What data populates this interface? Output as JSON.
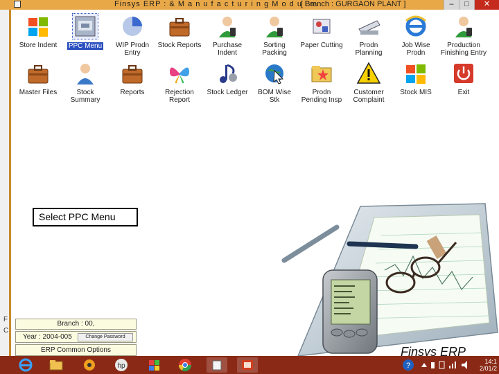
{
  "window": {
    "title": "Finsys ERP : & M a n u f a c t u r i n g   M o d u l e",
    "branch": "[ Branch : GURGAON PLANT ]",
    "minimize": "–",
    "maximize": "□",
    "close": "✕"
  },
  "left_frame": {
    "frag_top": "F",
    "frag_bottom": "C"
  },
  "icons": [
    {
      "label": "Store Indent",
      "icon": "windows-logo-icon"
    },
    {
      "label": "PPC Menu",
      "icon": "ppc-menu-icon",
      "selected": true
    },
    {
      "label": "WIP Prodn\nEntry",
      "icon": "pie-chart-icon"
    },
    {
      "label": "Stock Reports",
      "icon": "briefcase-icon"
    },
    {
      "label": "Purchase\nIndent",
      "icon": "user-phone-icon"
    },
    {
      "label": "Sorting\nPacking",
      "icon": "user-phone-icon"
    },
    {
      "label": "Paper Cutting",
      "icon": "tools-icon"
    },
    {
      "label": "Prodn\nPlanning",
      "icon": "scanner-icon"
    },
    {
      "label": "Job Wise\nProdn",
      "icon": "internet-explorer-icon"
    },
    {
      "label": "Production\nFinishing Entry",
      "icon": "user-phone-icon"
    },
    {
      "label": "Master Files",
      "icon": "briefcase-icon"
    },
    {
      "label": "Stock\nSummary",
      "icon": "user-icon"
    },
    {
      "label": "Reports",
      "icon": "briefcase-icon"
    },
    {
      "label": "Rejection\nReport",
      "icon": "butterfly-icon"
    },
    {
      "label": "Stock Ledger",
      "icon": "music-note-icon"
    },
    {
      "label": "BOM Wise\nStk",
      "icon": "globe-cursor-icon"
    },
    {
      "label": "Prodn\nPending Insp",
      "icon": "folder-star-icon"
    },
    {
      "label": "Customer\nComplaint",
      "icon": "warning-icon"
    },
    {
      "label": "Stock MIS",
      "icon": "windows-logo-icon"
    },
    {
      "label": "Exit",
      "icon": "power-icon"
    }
  ],
  "hint": "Select PPC Menu",
  "panels": {
    "branch": "Branch : 00,",
    "year": "Year : 2004-005",
    "change_password": "Change Password",
    "common_options": "ERP Common Options"
  },
  "brand": "Finsys ERP",
  "taskbar": {
    "clock_time": "14:1",
    "clock_date": "2/01/2"
  },
  "colors": {
    "titlebar": "#e8a848",
    "taskbar": "#8a2a16",
    "selection": "#2a4fbf",
    "frame_accent": "#c88a2c"
  }
}
